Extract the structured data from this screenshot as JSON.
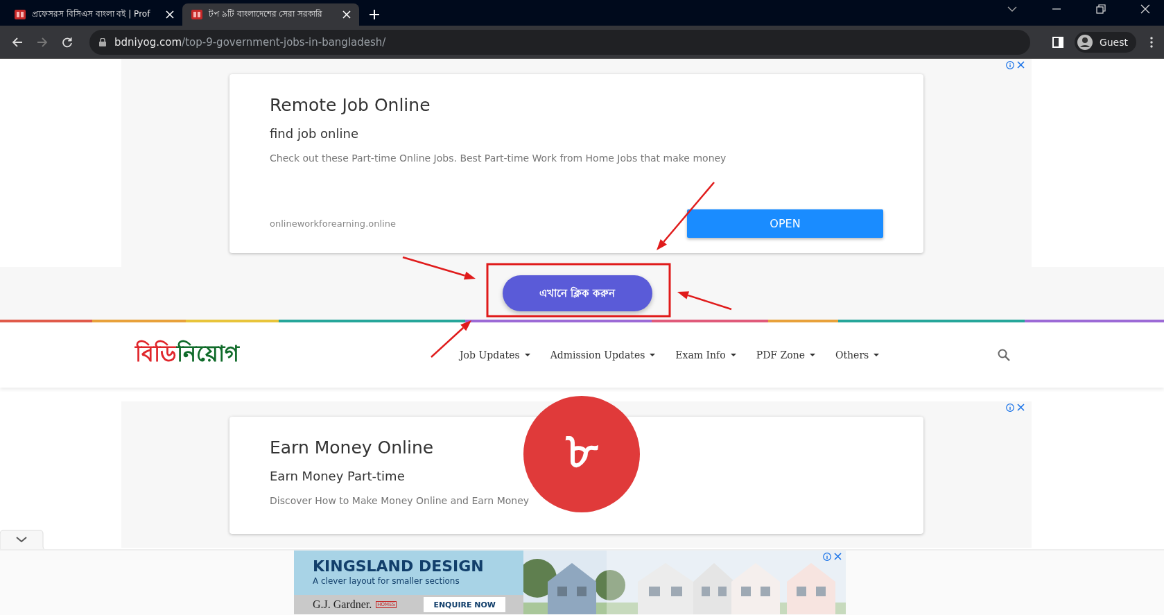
{
  "browser": {
    "tabs": [
      {
        "title": "প্রফেসরস বিসিএস বাংলা বই | Prof",
        "selected": false
      },
      {
        "title": "টপ ৯টি বাংলাদেশের সেরা সরকারি",
        "selected": true
      }
    ],
    "url": {
      "domain": "bdniyog.com",
      "path": "/top-9-government-jobs-in-bangladesh/"
    },
    "profile": "Guest"
  },
  "top_ad": {
    "title": "Remote Job Online",
    "subtitle": "find job online",
    "description": "Check out these Part-time Online Jobs. Best Part-time Work from Home Jobs that make money",
    "domain": "onlineworkforearning.online",
    "button": "OPEN"
  },
  "cta_button": "এখানে ক্লিক করুন",
  "site_header": {
    "logo": [
      "বিডি",
      "নিয়োগ"
    ],
    "nav": [
      {
        "label": "Job Updates"
      },
      {
        "label": "Admission Updates"
      },
      {
        "label": "Exam Info"
      },
      {
        "label": "PDF Zone"
      },
      {
        "label": "Others"
      }
    ]
  },
  "second_ad": {
    "title": "Earn Money Online",
    "subtitle": "Earn Money Part-time",
    "description": "Discover How to Make Money Online and Earn Money"
  },
  "bottom_ad": {
    "headline": "KINGSLAND DESIGN",
    "tagline": "A clever layout for smaller sections",
    "brand": "G.J. Gardner.",
    "brand_tag": "HOMES",
    "button": "ENQUIRE NOW"
  },
  "annotations": [
    {
      "kind": "arrow"
    },
    {
      "kind": "arrow"
    },
    {
      "kind": "arrow"
    },
    {
      "kind": "arrow"
    },
    {
      "kind": "frame"
    },
    {
      "kind": "badge",
      "text": "৮"
    }
  ]
}
